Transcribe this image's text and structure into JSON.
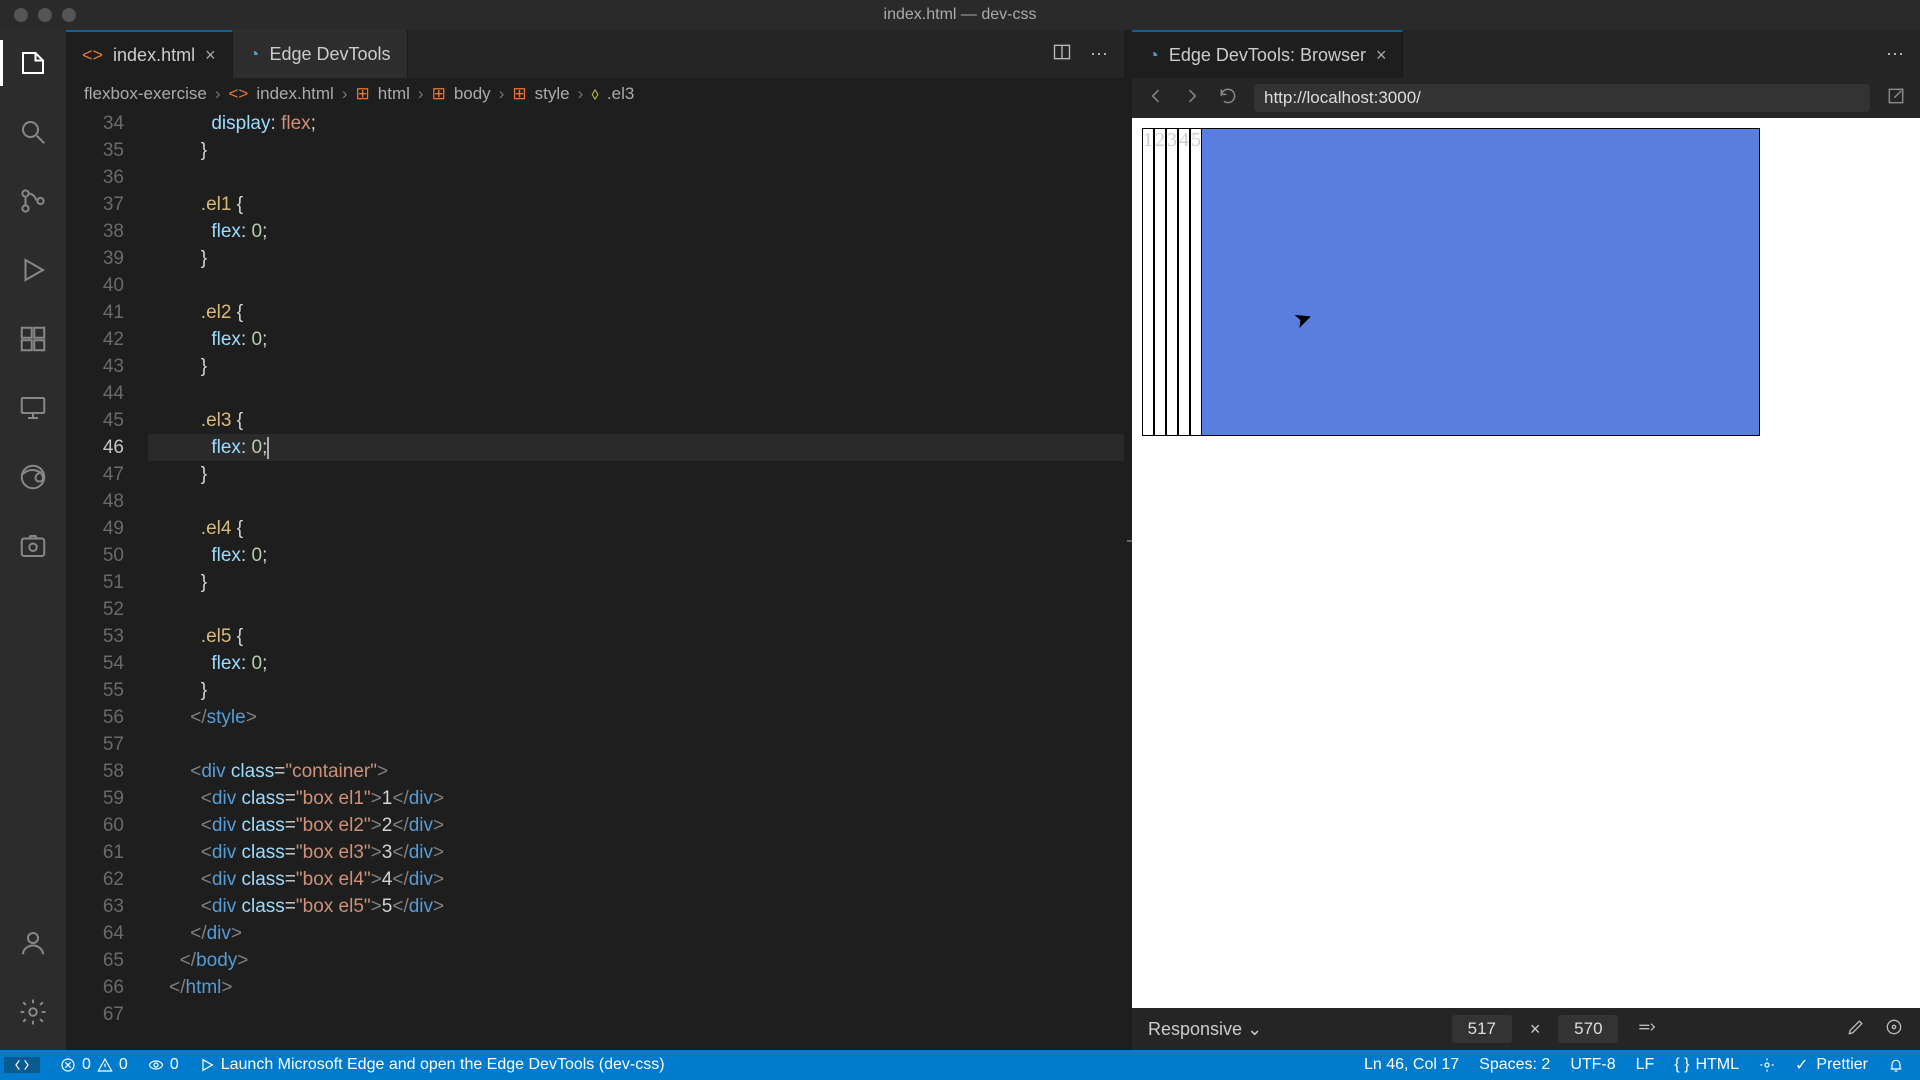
{
  "app_title": "index.html — dev-css",
  "tabs": {
    "editor": [
      {
        "label": "index.html",
        "active": true,
        "closable": true,
        "icon": "code-icon"
      },
      {
        "label": "Edge DevTools",
        "active": false,
        "closable": false,
        "icon": "edge-icon"
      }
    ],
    "browser": [
      {
        "label": "Edge DevTools: Browser",
        "active": true,
        "closable": true,
        "icon": "edge-icon"
      }
    ]
  },
  "breadcrumb": [
    "flexbox-exercise",
    "index.html",
    "html",
    "body",
    "style",
    ".el3"
  ],
  "url": "http://localhost:3000/",
  "boxes": [
    "1",
    "2",
    "3",
    "4",
    "5"
  ],
  "devtools": {
    "mode": "Responsive",
    "width": "517",
    "height": "570"
  },
  "status": {
    "errors": "0",
    "warnings": "0",
    "ports": "0",
    "launch": "Launch Microsoft Edge and open the Edge DevTools (dev-css)",
    "ln_col": "Ln 46, Col 17",
    "spaces": "Spaces: 2",
    "encoding": "UTF-8",
    "eol": "LF",
    "lang": "HTML",
    "prettier": "Prettier"
  },
  "sep_x": "×",
  "chevron": "›",
  "code_lines": [
    {
      "n": 34,
      "html": "            <span class='tok-prop'>display</span><span class='tok-punc'>:</span> <span class='tok-val'>flex</span><span class='tok-punc'>;</span>"
    },
    {
      "n": 35,
      "html": "          <span class='tok-punc'>}</span>"
    },
    {
      "n": 36,
      "html": ""
    },
    {
      "n": 37,
      "html": "          <span class='tok-sel'>.el1</span> <span class='tok-punc'>{</span>"
    },
    {
      "n": 38,
      "html": "            <span class='tok-prop'>flex</span><span class='tok-punc'>:</span> <span class='tok-num'>0</span><span class='tok-punc'>;</span>"
    },
    {
      "n": 39,
      "html": "          <span class='tok-punc'>}</span>"
    },
    {
      "n": 40,
      "html": ""
    },
    {
      "n": 41,
      "html": "          <span class='tok-sel'>.el2</span> <span class='tok-punc'>{</span>"
    },
    {
      "n": 42,
      "html": "            <span class='tok-prop'>flex</span><span class='tok-punc'>:</span> <span class='tok-num'>0</span><span class='tok-punc'>;</span>"
    },
    {
      "n": 43,
      "html": "          <span class='tok-punc'>}</span>"
    },
    {
      "n": 44,
      "html": ""
    },
    {
      "n": 45,
      "html": "          <span class='tok-sel'>.el3</span> <span class='tok-punc'>{</span>"
    },
    {
      "n": 46,
      "html": "            <span class='tok-prop'>flex</span><span class='tok-punc'>:</span> <span class='tok-num'>0</span><span class='tok-punc'>;</span><span class='cursor'></span>",
      "cur": true
    },
    {
      "n": 47,
      "html": "          <span class='tok-punc'>}</span>"
    },
    {
      "n": 48,
      "html": ""
    },
    {
      "n": 49,
      "html": "          <span class='tok-sel'>.el4</span> <span class='tok-punc'>{</span>"
    },
    {
      "n": 50,
      "html": "            <span class='tok-prop'>flex</span><span class='tok-punc'>:</span> <span class='tok-num'>0</span><span class='tok-punc'>;</span>"
    },
    {
      "n": 51,
      "html": "          <span class='tok-punc'>}</span>"
    },
    {
      "n": 52,
      "html": ""
    },
    {
      "n": 53,
      "html": "          <span class='tok-sel'>.el5</span> <span class='tok-punc'>{</span>"
    },
    {
      "n": 54,
      "html": "            <span class='tok-prop'>flex</span><span class='tok-punc'>:</span> <span class='tok-num'>0</span><span class='tok-punc'>;</span>"
    },
    {
      "n": 55,
      "html": "          <span class='tok-punc'>}</span>"
    },
    {
      "n": 56,
      "html": "        <span class='tok-br'>&lt;/</span><span class='tok-tag'>style</span><span class='tok-br'>&gt;</span>"
    },
    {
      "n": 57,
      "html": ""
    },
    {
      "n": 58,
      "html": "        <span class='tok-br'>&lt;</span><span class='tok-tag'>div</span> <span class='tok-attr'>class</span>=<span class='tok-str'>\"container\"</span><span class='tok-br'>&gt;</span>"
    },
    {
      "n": 59,
      "html": "          <span class='tok-br'>&lt;</span><span class='tok-tag'>div</span> <span class='tok-attr'>class</span>=<span class='tok-str'>\"box el1\"</span><span class='tok-br'>&gt;</span>1<span class='tok-br'>&lt;/</span><span class='tok-tag'>div</span><span class='tok-br'>&gt;</span>"
    },
    {
      "n": 60,
      "html": "          <span class='tok-br'>&lt;</span><span class='tok-tag'>div</span> <span class='tok-attr'>class</span>=<span class='tok-str'>\"box el2\"</span><span class='tok-br'>&gt;</span>2<span class='tok-br'>&lt;/</span><span class='tok-tag'>div</span><span class='tok-br'>&gt;</span>"
    },
    {
      "n": 61,
      "html": "          <span class='tok-br'>&lt;</span><span class='tok-tag'>div</span> <span class='tok-attr'>class</span>=<span class='tok-str'>\"box el3\"</span><span class='tok-br'>&gt;</span>3<span class='tok-br'>&lt;/</span><span class='tok-tag'>div</span><span class='tok-br'>&gt;</span>"
    },
    {
      "n": 62,
      "html": "          <span class='tok-br'>&lt;</span><span class='tok-tag'>div</span> <span class='tok-attr'>class</span>=<span class='tok-str'>\"box el4\"</span><span class='tok-br'>&gt;</span>4<span class='tok-br'>&lt;/</span><span class='tok-tag'>div</span><span class='tok-br'>&gt;</span>"
    },
    {
      "n": 63,
      "html": "          <span class='tok-br'>&lt;</span><span class='tok-tag'>div</span> <span class='tok-attr'>class</span>=<span class='tok-str'>\"box el5\"</span><span class='tok-br'>&gt;</span>5<span class='tok-br'>&lt;/</span><span class='tok-tag'>div</span><span class='tok-br'>&gt;</span>"
    },
    {
      "n": 64,
      "html": "        <span class='tok-br'>&lt;/</span><span class='tok-tag'>div</span><span class='tok-br'>&gt;</span>"
    },
    {
      "n": 65,
      "html": "      <span class='tok-br'>&lt;/</span><span class='tok-tag'>body</span><span class='tok-br'>&gt;</span>"
    },
    {
      "n": 66,
      "html": "    <span class='tok-br'>&lt;/</span><span class='tok-tag'>html</span><span class='tok-br'>&gt;</span>"
    },
    {
      "n": 67,
      "html": ""
    }
  ]
}
